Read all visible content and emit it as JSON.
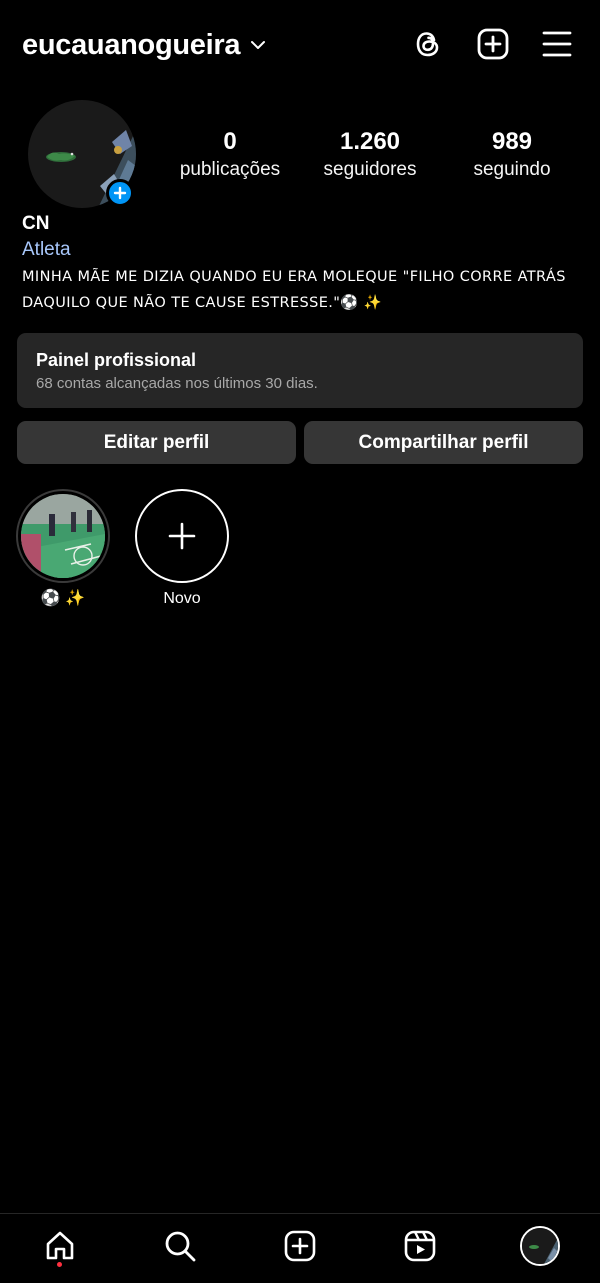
{
  "header": {
    "username": "eucauanogueira"
  },
  "profile": {
    "stats": {
      "posts_value": "0",
      "posts_label": "publicações",
      "followers_value": "1.260",
      "followers_label": "seguidores",
      "following_value": "989",
      "following_label": "seguindo"
    },
    "name": "CN",
    "category": "Atleta",
    "bio": "MINHA MÃE ME DIZIA QUANDO EU ERA MOLEQUE \"FILHO CORRE ATRÁS DAQUILO QUE NÃO TE CAUSE ESTRESSE.\"⚽ ✨"
  },
  "panel": {
    "title": "Painel profissional",
    "subtitle": "68 contas alcançadas nos últimos 30 dias."
  },
  "buttons": {
    "edit": "Editar perfil",
    "share": "Compartilhar perfil"
  },
  "highlights": [
    {
      "label": "⚽ ✨"
    },
    {
      "label": "Novo"
    }
  ],
  "colors": {
    "background": "#000000",
    "surface": "#262626",
    "button": "#363636",
    "accent_blue": "#0095f6",
    "category_text": "#a8c7fa",
    "notification_dot": "#ff3040"
  },
  "icons": {
    "header": [
      "chevron-down-icon",
      "threads-icon",
      "add-post-icon",
      "menu-icon"
    ],
    "nav": [
      "home-icon",
      "search-icon",
      "create-icon",
      "reels-icon",
      "profile-avatar"
    ]
  }
}
